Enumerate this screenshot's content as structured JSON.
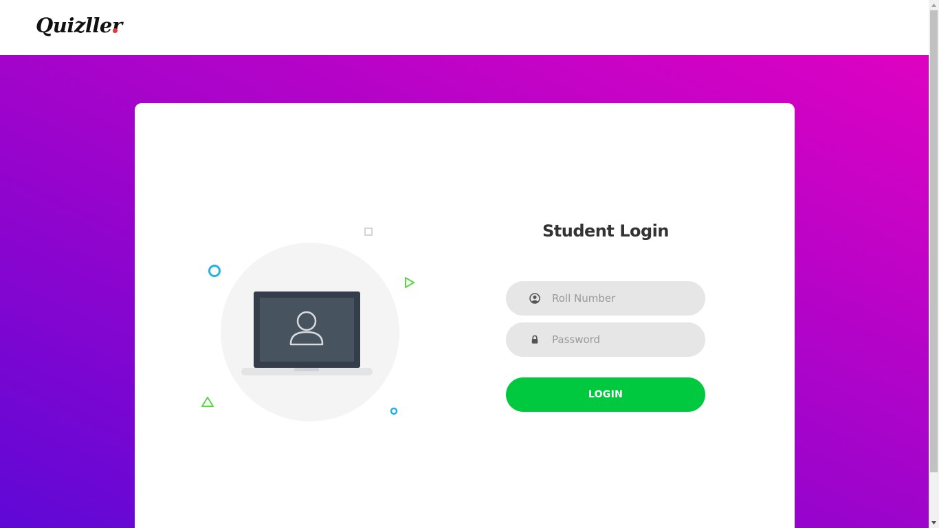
{
  "header": {
    "brand": "Quizller"
  },
  "login": {
    "title": "Student Login",
    "roll_placeholder": "Roll Number",
    "password_placeholder": "Password",
    "button_label": "LOGIN"
  },
  "icons": {
    "roll": "user-circle-icon",
    "password": "lock-icon",
    "illustration": "laptop-user-icon"
  },
  "colors": {
    "brand_dot": "#e8333a",
    "gradient_start": "#5f08d6",
    "gradient_end": "#de02c2",
    "login_button": "#00c83f",
    "input_bg": "#e6e6e6",
    "title": "#333333"
  }
}
